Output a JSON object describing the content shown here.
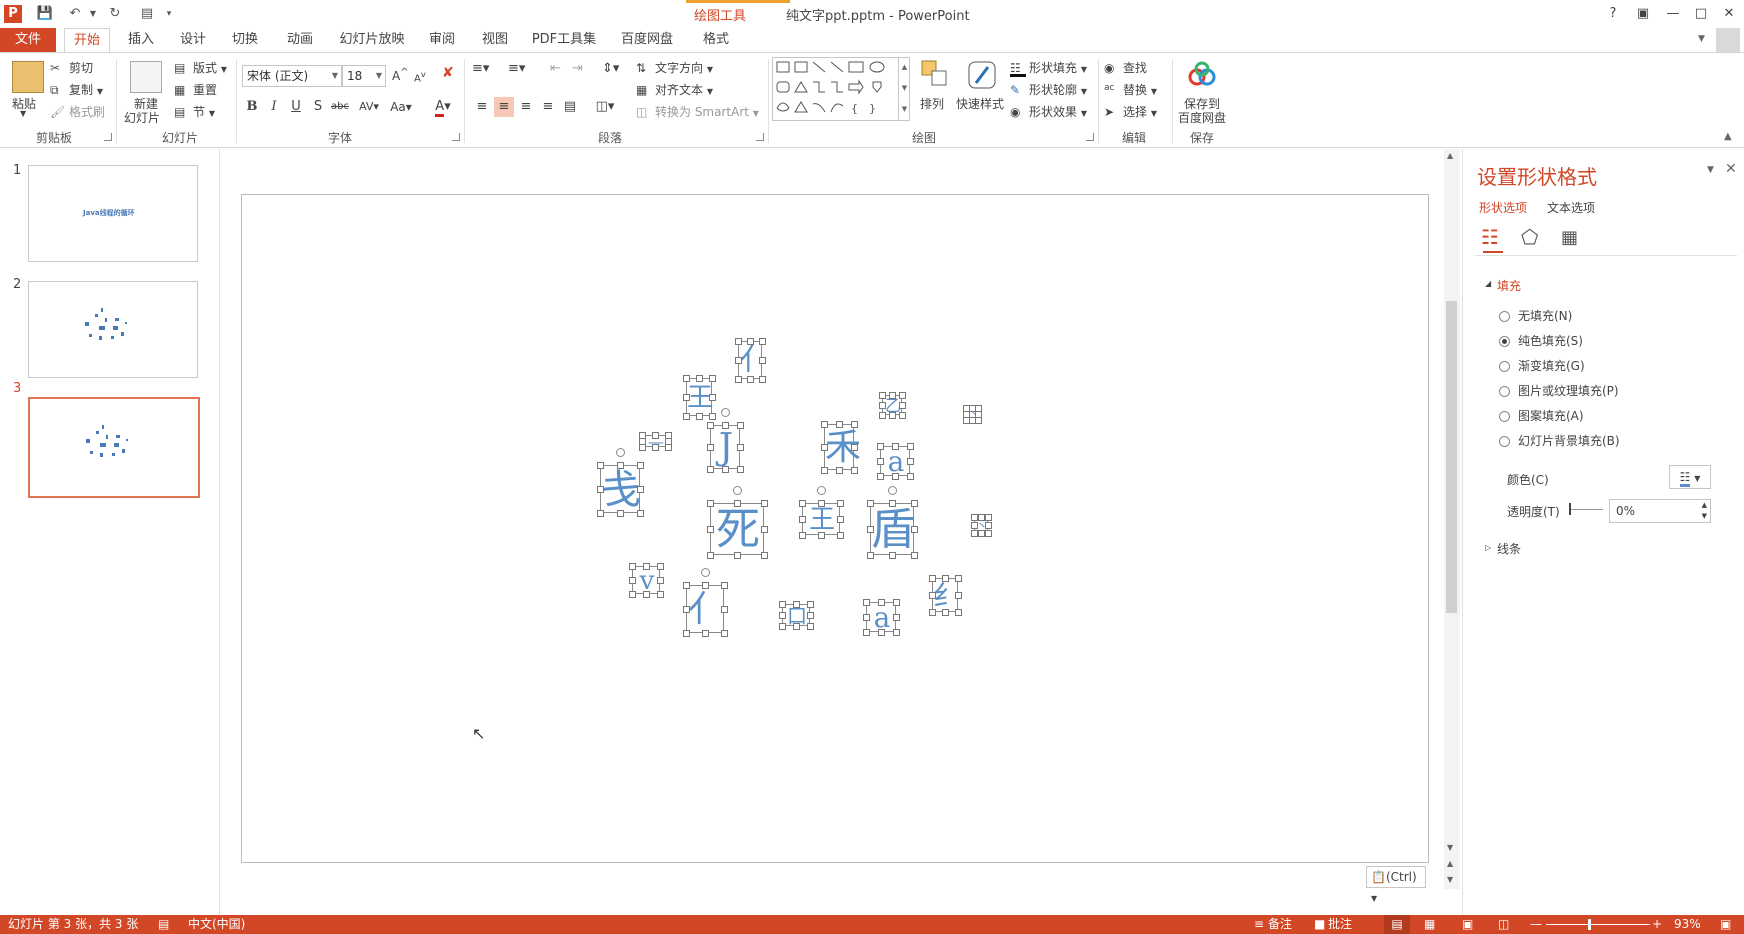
{
  "app": {
    "contextual_tab_group": "绘图工具",
    "document_title": "纯文字ppt.pptm - PowerPoint",
    "user_help": "?"
  },
  "tabs": [
    "文件",
    "开始",
    "插入",
    "设计",
    "切换",
    "动画",
    "幻灯片放映",
    "审阅",
    "视图",
    "PDF工具集",
    "百度网盘",
    "格式"
  ],
  "ribbon": {
    "clipboard": {
      "paste": "粘贴",
      "cut": "剪切",
      "copy": "复制",
      "format_painter": "格式刷",
      "label": "剪贴板"
    },
    "slides": {
      "new_slide_line1": "新建",
      "new_slide_line2": "幻灯片",
      "layout": "版式",
      "reset": "重置",
      "section": "节",
      "label": "幻灯片"
    },
    "font": {
      "font_name": "宋体 (正文)",
      "font_size": "18",
      "label": "字体"
    },
    "paragraph": {
      "text_direction": "文字方向",
      "align_text": "对齐文本",
      "convert_smartart": "转换为 SmartArt",
      "label": "段落"
    },
    "drawing": {
      "arrange": "排列",
      "quick_styles": "快速样式",
      "shape_fill": "形状填充",
      "shape_outline": "形状轮廓",
      "shape_effects": "形状效果",
      "label": "绘图"
    },
    "editing": {
      "find": "查找",
      "replace": "替换",
      "select": "选择",
      "label": "编辑"
    },
    "save": {
      "save_line1": "保存到",
      "save_line2": "百度网盘",
      "label": "保存"
    }
  },
  "thumbnails": [
    {
      "number": "1",
      "text": "Java线程的循环"
    },
    {
      "number": "2",
      "text": ""
    },
    {
      "number": "3",
      "text": ""
    }
  ],
  "slide_glyphs": [
    {
      "char": "亻",
      "size": 30
    },
    {
      "char": "王",
      "size": 26
    },
    {
      "char": "J",
      "size": 36
    },
    {
      "char": "禾",
      "size": 36
    },
    {
      "char": "a",
      "size": 28
    },
    {
      "char": "戋",
      "size": 40
    },
    {
      "char": "死",
      "size": 44
    },
    {
      "char": "王",
      "size": 26
    },
    {
      "char": "盾",
      "size": 44
    },
    {
      "char": "v",
      "size": 26
    },
    {
      "char": "亻",
      "size": 36
    },
    {
      "char": "口",
      "size": 20
    },
    {
      "char": "a",
      "size": 28
    },
    {
      "char": "纟",
      "size": 28
    },
    {
      "char": "乙",
      "size": 16
    },
    {
      "char": "—",
      "size": 16
    },
    {
      "char": "丶",
      "size": 10
    },
    {
      "char": "丶",
      "size": 12
    }
  ],
  "paste_options": "(Ctrl)",
  "format_pane": {
    "title": "设置形状格式",
    "tab_shape": "形状选项",
    "tab_text": "文本选项",
    "fill_section": "填充",
    "options": [
      "无填充(N)",
      "纯色填充(S)",
      "渐变填充(G)",
      "图片或纹理填充(P)",
      "图案填充(A)",
      "幻灯片背景填充(B)"
    ],
    "selected_option": 1,
    "color_label": "颜色(C)",
    "transparency_label": "透明度(T)",
    "transparency_value": "0%",
    "line_section": "线条"
  },
  "status": {
    "slide_info": "幻灯片 第 3 张，共 3 张",
    "language": "中文(中国)",
    "notes": "备注",
    "comments": "批注",
    "zoom": "93%"
  },
  "colors": {
    "accent": "#d24726",
    "text_fill": "#5b8fc7"
  }
}
